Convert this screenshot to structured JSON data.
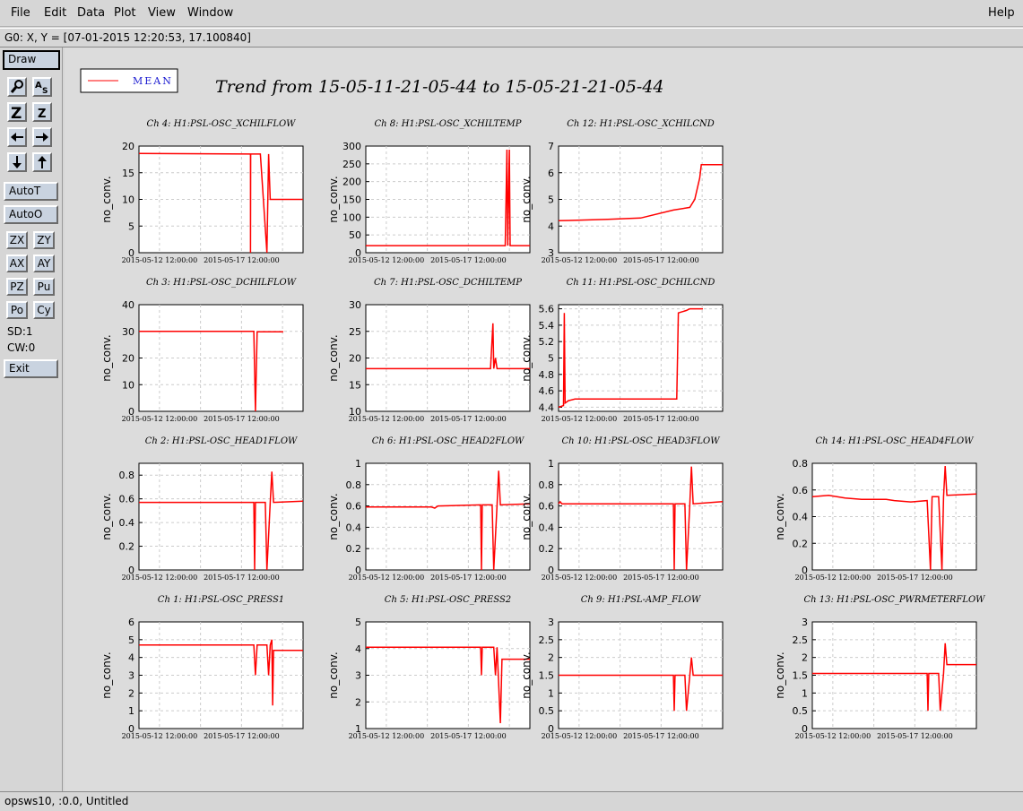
{
  "menubar": {
    "file": "File",
    "edit": "Edit",
    "data": "Data",
    "plot": "Plot",
    "view": "View",
    "window": "Window",
    "help": "Help"
  },
  "statusline": "G0: X, Y = [07-01-2015 12:20:53, 17.100840]",
  "sidebar": {
    "draw": "Draw",
    "autot": "AutoT",
    "autoo": "AutoO",
    "zx": "ZX",
    "zy": "ZY",
    "ax": "AX",
    "ay": "AY",
    "pz": "PZ",
    "pu": "Pu",
    "po": "Po",
    "cy": "Cy",
    "sd": "SD:1",
    "cw": "CW:0",
    "exit": "Exit",
    "icons": [
      "zoom-icon",
      "auto-scale-icon",
      "zoom-in-icon",
      "zoom-out-icon",
      "left-arrow-icon",
      "right-arrow-icon",
      "down-arrow-icon",
      "up-arrow-icon"
    ]
  },
  "footer": "opsws10, :0.0, Untitled",
  "chart_data": {
    "type": "line",
    "title": "Trend from 15-05-11-21-05-44 to 15-05-21-21-05-44",
    "legend": {
      "label": "MEAN",
      "color": "#ff0000",
      "placement": "top-left"
    },
    "xlabel_ticks": [
      "2015-05-12 12:00:00",
      "2015-05-17 12:00:00"
    ],
    "grid": true,
    "series_color": "#ff0000",
    "panels": [
      {
        "title": "Ch 4: H1:PSL-OSC_XCHILFLOW",
        "ylabel": "no_conv.",
        "yticks": [
          "0",
          "5",
          "10",
          "15",
          "20"
        ],
        "ylim": [
          0,
          20
        ],
        "segments": [
          [
            0,
            18.6
          ],
          [
            0.68,
            18.5
          ],
          [
            0.68,
            0
          ],
          [
            0.681,
            18.5
          ],
          [
            0.74,
            18.5
          ],
          [
            0.78,
            0
          ],
          [
            0.79,
            18.5
          ],
          [
            0.8,
            10
          ],
          [
            1.0,
            10
          ]
        ],
        "x_end": 1.0
      },
      {
        "title": "Ch 8: H1:PSL-OSC_XCHILTEMP",
        "ylabel": "no_conv.",
        "yticks": [
          "0",
          "50",
          "100",
          "150",
          "200",
          "250",
          "300"
        ],
        "ylim": [
          0,
          300
        ],
        "segments": [
          [
            0,
            20
          ],
          [
            0.85,
            20
          ],
          [
            0.86,
            290
          ],
          [
            0.865,
            20
          ],
          [
            0.875,
            290
          ],
          [
            0.88,
            20
          ],
          [
            1.0,
            20
          ]
        ],
        "x_end": 1.0
      },
      {
        "title": "Ch 12: H1:PSL-OSC_XCHILCND",
        "ylabel": "no_conv.",
        "yticks": [
          "3",
          "4",
          "5",
          "6",
          "7"
        ],
        "ylim": [
          3,
          7
        ],
        "segments": [
          [
            0,
            4.2
          ],
          [
            0.3,
            4.25
          ],
          [
            0.5,
            4.3
          ],
          [
            0.7,
            4.6
          ],
          [
            0.8,
            4.7
          ],
          [
            0.83,
            5.0
          ],
          [
            0.86,
            5.8
          ],
          [
            0.87,
            6.3
          ],
          [
            1.0,
            6.3
          ]
        ],
        "x_end": 1.0
      },
      {
        "title": "Ch 3: H1:PSL-OSC_DCHILFLOW",
        "ylabel": "no_conv.",
        "yticks": [
          "0",
          "10",
          "20",
          "30",
          "40"
        ],
        "ylim": [
          0,
          40
        ],
        "segments": [
          [
            0,
            30
          ],
          [
            0.7,
            30
          ],
          [
            0.71,
            0
          ],
          [
            0.72,
            29.8
          ],
          [
            0.88,
            29.8
          ]
        ],
        "x_end": 0.88
      },
      {
        "title": "Ch 7: H1:PSL-OSC_DCHILTEMP",
        "ylabel": "no_conv.",
        "yticks": [
          "10",
          "15",
          "20",
          "25",
          "30"
        ],
        "ylim": [
          10,
          30
        ],
        "segments": [
          [
            0,
            18
          ],
          [
            0.76,
            18
          ],
          [
            0.775,
            26.5
          ],
          [
            0.78,
            18
          ],
          [
            0.79,
            20
          ],
          [
            0.8,
            18
          ],
          [
            1.0,
            18
          ]
        ],
        "x_end": 1.0
      },
      {
        "title": "Ch 11: H1:PSL-OSC_DCHILCND",
        "ylabel": "no_conv.",
        "yticks": [
          "4.4",
          "4.6",
          "4.8",
          "5",
          "5.2",
          "5.4",
          "5.6"
        ],
        "ylim": [
          4.35,
          5.65
        ],
        "segments": [
          [
            0,
            4.4
          ],
          [
            0.03,
            4.42
          ],
          [
            0.035,
            5.55
          ],
          [
            0.04,
            4.45
          ],
          [
            0.06,
            4.48
          ],
          [
            0.1,
            4.5
          ],
          [
            0.72,
            4.5
          ],
          [
            0.73,
            5.55
          ],
          [
            0.78,
            5.58
          ],
          [
            0.8,
            5.6
          ],
          [
            0.88,
            5.6
          ]
        ],
        "x_end": 0.88
      },
      {
        "title": "Ch 2: H1:PSL-OSC_HEAD1FLOW",
        "ylabel": "no_conv.",
        "yticks": [
          "0",
          "0.2",
          "0.4",
          "0.6",
          "0.8"
        ],
        "ylim": [
          0,
          0.9
        ],
        "segments": [
          [
            0,
            0.57
          ],
          [
            0.7,
            0.57
          ],
          [
            0.705,
            0
          ],
          [
            0.71,
            0.57
          ],
          [
            0.77,
            0.57
          ],
          [
            0.78,
            0
          ],
          [
            0.8,
            0.57
          ],
          [
            0.81,
            0.83
          ],
          [
            0.82,
            0.57
          ],
          [
            1.0,
            0.58
          ]
        ],
        "x_end": 1.0
      },
      {
        "title": "Ch 6: H1:PSL-OSC_HEAD2FLOW",
        "ylabel": "no_conv.",
        "yticks": [
          "0",
          "0.2",
          "0.4",
          "0.6",
          "0.8",
          "1"
        ],
        "ylim": [
          0,
          1
        ],
        "segments": [
          [
            0,
            0.59
          ],
          [
            0.4,
            0.59
          ],
          [
            0.42,
            0.58
          ],
          [
            0.44,
            0.6
          ],
          [
            0.7,
            0.61
          ],
          [
            0.705,
            0
          ],
          [
            0.71,
            0.61
          ],
          [
            0.77,
            0.61
          ],
          [
            0.78,
            0
          ],
          [
            0.8,
            0.61
          ],
          [
            0.81,
            0.93
          ],
          [
            0.82,
            0.61
          ],
          [
            1.0,
            0.62
          ]
        ],
        "x_end": 1.0
      },
      {
        "title": "Ch 10: H1:PSL-OSC_HEAD3FLOW",
        "ylabel": "no_conv.",
        "yticks": [
          "0",
          "0.2",
          "0.4",
          "0.6",
          "0.8",
          "1"
        ],
        "ylim": [
          0,
          1
        ],
        "segments": [
          [
            0,
            0.62
          ],
          [
            0.01,
            0.64
          ],
          [
            0.02,
            0.62
          ],
          [
            0.7,
            0.62
          ],
          [
            0.705,
            0
          ],
          [
            0.71,
            0.62
          ],
          [
            0.77,
            0.62
          ],
          [
            0.78,
            0
          ],
          [
            0.8,
            0.62
          ],
          [
            0.81,
            0.97
          ],
          [
            0.82,
            0.62
          ],
          [
            1.0,
            0.64
          ]
        ],
        "x_end": 1.0
      },
      {
        "title": "Ch 14: H1:PSL-OSC_HEAD4FLOW",
        "ylabel": "no_conv.",
        "yticks": [
          "0",
          "0.2",
          "0.4",
          "0.6",
          "0.8"
        ],
        "ylim": [
          0,
          0.8
        ],
        "segments": [
          [
            0,
            0.55
          ],
          [
            0.1,
            0.56
          ],
          [
            0.2,
            0.54
          ],
          [
            0.3,
            0.53
          ],
          [
            0.45,
            0.53
          ],
          [
            0.5,
            0.52
          ],
          [
            0.6,
            0.51
          ],
          [
            0.7,
            0.52
          ],
          [
            0.72,
            0.0
          ],
          [
            0.73,
            0.55
          ],
          [
            0.77,
            0.55
          ],
          [
            0.79,
            0.0
          ],
          [
            0.8,
            0.55
          ],
          [
            0.81,
            0.78
          ],
          [
            0.82,
            0.56
          ],
          [
            1.0,
            0.57
          ]
        ],
        "x_end": 1.0
      },
      {
        "title": "Ch 1: H1:PSL-OSC_PRESS1",
        "ylabel": "no_conv.",
        "yticks": [
          "0",
          "1",
          "2",
          "3",
          "4",
          "5",
          "6"
        ],
        "ylim": [
          0,
          6
        ],
        "segments": [
          [
            0,
            4.7
          ],
          [
            0.7,
            4.7
          ],
          [
            0.71,
            3.0
          ],
          [
            0.72,
            4.7
          ],
          [
            0.78,
            4.7
          ],
          [
            0.79,
            3.0
          ],
          [
            0.8,
            4.7
          ],
          [
            0.81,
            5.0
          ],
          [
            0.815,
            1.3
          ],
          [
            0.82,
            4.4
          ],
          [
            1.0,
            4.4
          ]
        ],
        "x_end": 1.0
      },
      {
        "title": "Ch 5: H1:PSL-OSC_PRESS2",
        "ylabel": "no_conv.",
        "yticks": [
          "1",
          "2",
          "3",
          "4",
          "5"
        ],
        "ylim": [
          1,
          5
        ],
        "segments": [
          [
            0,
            4.05
          ],
          [
            0.7,
            4.05
          ],
          [
            0.705,
            3.0
          ],
          [
            0.71,
            4.05
          ],
          [
            0.78,
            4.05
          ],
          [
            0.79,
            3.0
          ],
          [
            0.8,
            4.05
          ],
          [
            0.82,
            1.2
          ],
          [
            0.83,
            3.6
          ],
          [
            1.0,
            3.6
          ]
        ],
        "x_end": 1.0
      },
      {
        "title": "Ch 9: H1:PSL-AMP_FLOW",
        "ylabel": "no_conv.",
        "yticks": [
          "0",
          "0.5",
          "1",
          "1.5",
          "2",
          "2.5",
          "3"
        ],
        "ylim": [
          0,
          3
        ],
        "segments": [
          [
            0,
            1.5
          ],
          [
            0.7,
            1.5
          ],
          [
            0.705,
            0.5
          ],
          [
            0.71,
            1.5
          ],
          [
            0.77,
            1.5
          ],
          [
            0.78,
            0.5
          ],
          [
            0.8,
            1.5
          ],
          [
            0.81,
            2.0
          ],
          [
            0.82,
            1.5
          ],
          [
            1.0,
            1.5
          ]
        ],
        "x_end": 1.0
      },
      {
        "title": "Ch 13: H1:PSL-OSC_PWRMETERFLOW",
        "ylabel": "no_conv.",
        "yticks": [
          "0",
          "0.5",
          "1",
          "1.5",
          "2",
          "2.5",
          "3"
        ],
        "ylim": [
          0,
          3
        ],
        "segments": [
          [
            0,
            1.55
          ],
          [
            0.7,
            1.55
          ],
          [
            0.705,
            0.5
          ],
          [
            0.71,
            1.55
          ],
          [
            0.77,
            1.55
          ],
          [
            0.78,
            0.5
          ],
          [
            0.8,
            1.55
          ],
          [
            0.81,
            2.4
          ],
          [
            0.82,
            1.8
          ],
          [
            1.0,
            1.8
          ]
        ],
        "x_end": 1.0
      }
    ]
  }
}
